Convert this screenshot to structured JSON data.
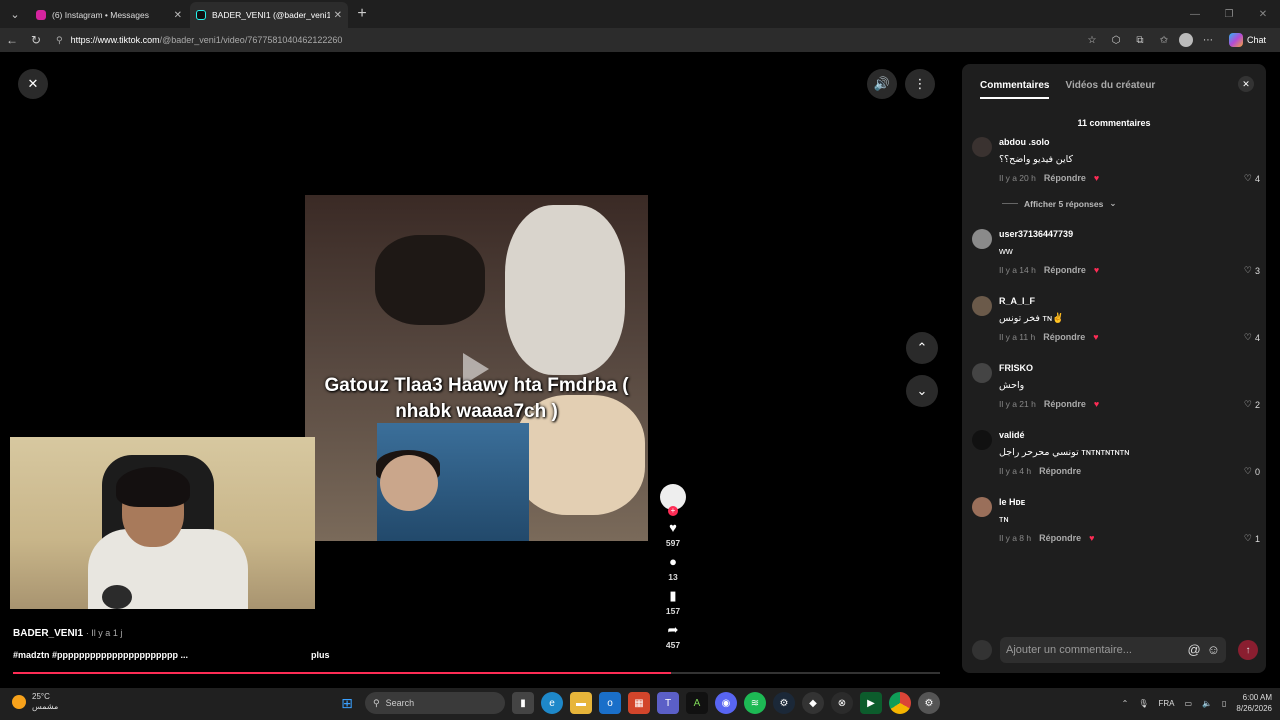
{
  "browser": {
    "tabs": [
      {
        "title": "(6) Instagram • Messages",
        "favicon_color": "#d6249f",
        "active": false
      },
      {
        "title": "BADER_VENI1 (@bader_veni1) | Ti",
        "favicon_color": "#000000",
        "active": true
      }
    ],
    "url_host": "https://www.tiktok.com",
    "url_path": "/@bader_veni1/video/7677581040462122260",
    "chat_label": "Chat"
  },
  "video": {
    "caption": "Gatouz Tlaa3 Haawy hta Fmdrba ( nhabk waaaa7ch )",
    "author": "BADER_VENI1",
    "time": "· Il y a 1 j",
    "hashtags": "#madztn #pppppppppppppppppppppp ...",
    "more_label": "plus",
    "progress_fraction": 0.71,
    "stats": {
      "likes": "597",
      "comments": "13",
      "saves": "157",
      "shares": "457"
    }
  },
  "panel": {
    "tab_comments": "Commentaires",
    "tab_creator_videos": "Vidéos du créateur",
    "count_label": "11 commentaires",
    "show_replies": "Afficher 5 réponses",
    "reply_label": "Répondre",
    "input_placeholder": "Ajouter un commentaire...",
    "comments": [
      {
        "user": "abdou .solo",
        "text": "كاين فيديو واضح؟؟",
        "time": "Il y a 20 h",
        "likes": "4"
      },
      {
        "user": "user37136447739",
        "text": "ww",
        "time": "Il y a 14 h",
        "likes": "3"
      },
      {
        "user": "R_A_I_F",
        "text": "فخر تونس ᴛɴ✌️",
        "time": "Il y a 11 h",
        "likes": "4"
      },
      {
        "user": "FRISKO",
        "text": "واحش",
        "time": "Il y a 21 h",
        "likes": "2"
      },
      {
        "user": "validé",
        "text": "تونسي محرحر راجل ᴛɴᴛɴᴛɴᴛɴᴛɴ",
        "time": "Il y a 4 h",
        "likes": "0"
      },
      {
        "user": "le Hᴅᴇ",
        "text": "ᴛɴ",
        "time": "Il y a 8 h",
        "likes": "1"
      }
    ]
  },
  "taskbar": {
    "weather_temp": "25°C",
    "weather_desc": "مشمس",
    "search_label": "Search",
    "lang": "FRA",
    "time": "6:00 AM",
    "date": "8/26/2026"
  },
  "colors": {
    "accent": "#fe2c55",
    "panel_bg": "#1e1e1e"
  }
}
